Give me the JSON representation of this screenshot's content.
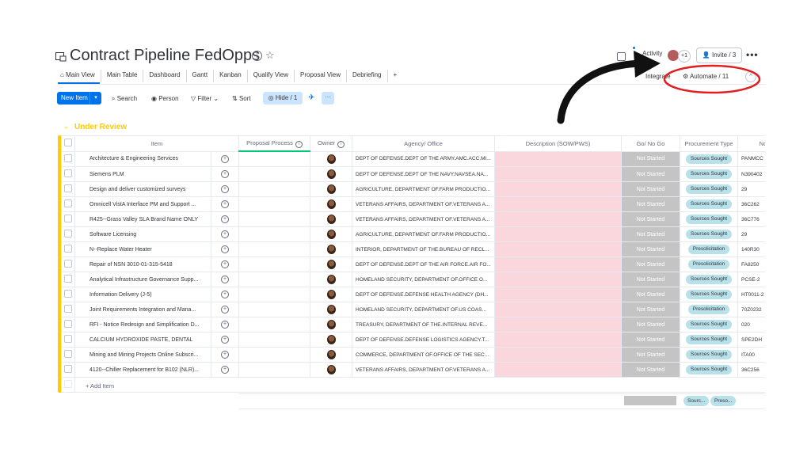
{
  "board": {
    "title": "Contract Pipeline FedOpps",
    "activity_label": "Activity",
    "activity_count": "+1",
    "invite_label": "Invite / 3",
    "more": "•••"
  },
  "tabs": [
    {
      "label": "Main View"
    },
    {
      "label": "Main Table"
    },
    {
      "label": "Dashboard"
    },
    {
      "label": "Gantt"
    },
    {
      "label": "Kanban"
    },
    {
      "label": "Qualify View"
    },
    {
      "label": "Proposal View"
    },
    {
      "label": "Debriefing"
    },
    {
      "label": "+"
    }
  ],
  "integrate_label": "Integrate",
  "automate_label": "Automate / 11",
  "toolbar": {
    "new_item": "New Item",
    "search": "Search",
    "person": "Person",
    "filter": "Filter",
    "sort": "Sort",
    "hide": "Hide / 1",
    "more": "···"
  },
  "group": {
    "title": "Under Review",
    "color": "#ffcb00"
  },
  "columns": [
    "Item",
    "Proposal Process",
    "Owner",
    "Agency/ Office",
    "Description (SOW/PWS)",
    "Go/ No Go",
    "Procurement Type",
    "Not"
  ],
  "rows": [
    {
      "item": "Architecture & Engineering Services",
      "agency": "DEPT OF DEFENSE.DEPT OF THE ARMY.AMC.ACC.MI...",
      "status": "Not Started",
      "type": "Sources Sought",
      "notes": "PANMCC"
    },
    {
      "item": "Siemens PLM",
      "agency": "DEPT OF DEFENSE.DEPT OF THE NAVY.NAVSEA.NA...",
      "status": "Not Started",
      "type": "Sources Sought",
      "notes": "N390402"
    },
    {
      "item": "Design and deliver customized surveys",
      "agency": "AGRICULTURE, DEPARTMENT OF.FARM PRODUCTIO...",
      "status": "Not Started",
      "type": "Sources Sought",
      "notes": "29"
    },
    {
      "item": "Omnicell VistA Interface PM and Support ...",
      "agency": "VETERANS AFFAIRS, DEPARTMENT OF.VETERANS A...",
      "status": "Not Started",
      "type": "Sources Sought",
      "notes": "36C262"
    },
    {
      "item": "R425--Grass Valley SLA Brand Name ONLY",
      "agency": "VETERANS AFFAIRS, DEPARTMENT OF.VETERANS A...",
      "status": "Not Started",
      "type": "Sources Sought",
      "notes": "36C776"
    },
    {
      "item": "Software Licensing",
      "agency": "AGRICULTURE, DEPARTMENT OF.FARM PRODUCTIO...",
      "status": "Not Started",
      "type": "Sources Sought",
      "notes": "29"
    },
    {
      "item": "N--Replace Water Heater",
      "agency": "INTERIOR, DEPARTMENT OF THE.BUREAU OF RECL...",
      "status": "Not Started",
      "type": "Presolicitation",
      "notes": "140R30"
    },
    {
      "item": "Repair of NSN 3010-01-315-5418",
      "agency": "DEPT OF DEFENSE.DEPT OF THE AIR FORCE.AIR FO...",
      "status": "Not Started",
      "type": "Presolicitation",
      "notes": "FA8250"
    },
    {
      "item": "Analytical Infrastructure Governance Supp...",
      "agency": "HOMELAND SECURITY, DEPARTMENT OF.OFFICE O...",
      "status": "Not Started",
      "type": "Sources Sought",
      "notes": "PCSE-2"
    },
    {
      "item": "Information Delivery (J-5)",
      "agency": "DEPT OF DEFENSE.DEFENSE HEALTH AGENCY (DH...",
      "status": "Not Started",
      "type": "Sources Sought",
      "notes": "HT0011-2"
    },
    {
      "item": "Joint Requirements Integration and Mana...",
      "agency": "HOMELAND SECURITY, DEPARTMENT OF.US COAS...",
      "status": "Not Started",
      "type": "Presolicitation",
      "notes": "70Z0232"
    },
    {
      "item": "RFI - Notice Redesign and Simplification D...",
      "agency": "TREASURY, DEPARTMENT OF THE.INTERNAL REVE...",
      "status": "Not Started",
      "type": "Sources Sought",
      "notes": "020"
    },
    {
      "item": "CALCIUM HYDROXIDE PASTE, DENTAL",
      "agency": "DEPT OF DEFENSE.DEFENSE LOGISTICS AGENCY.T...",
      "status": "Not Started",
      "type": "Sources Sought",
      "notes": "SPE2DH"
    },
    {
      "item": "Mining and Mining Projects Online Subscri...",
      "agency": "COMMERCE, DEPARTMENT OF.OFFICE OF THE SEC...",
      "status": "Not Started",
      "type": "Sources Sought",
      "notes": "ITA00"
    },
    {
      "item": "4120--Chiller Replacement for B102 (NLR)...",
      "agency": "VETERANS AFFAIRS, DEPARTMENT OF.VETERANS A...",
      "status": "Not Started",
      "type": "Sources Sought",
      "notes": "36C256"
    }
  ],
  "add_item_label": "+ Add Item",
  "summary": {
    "type_pill_1": "Sourc...",
    "type_pill_2": "Preso..."
  },
  "colors": {
    "primary": "#0073ea",
    "status_gray": "#c4c4c4",
    "description_pink": "#f9d7dc",
    "pill_blue": "#b9e1ea",
    "annotation_red": "#e02020"
  }
}
